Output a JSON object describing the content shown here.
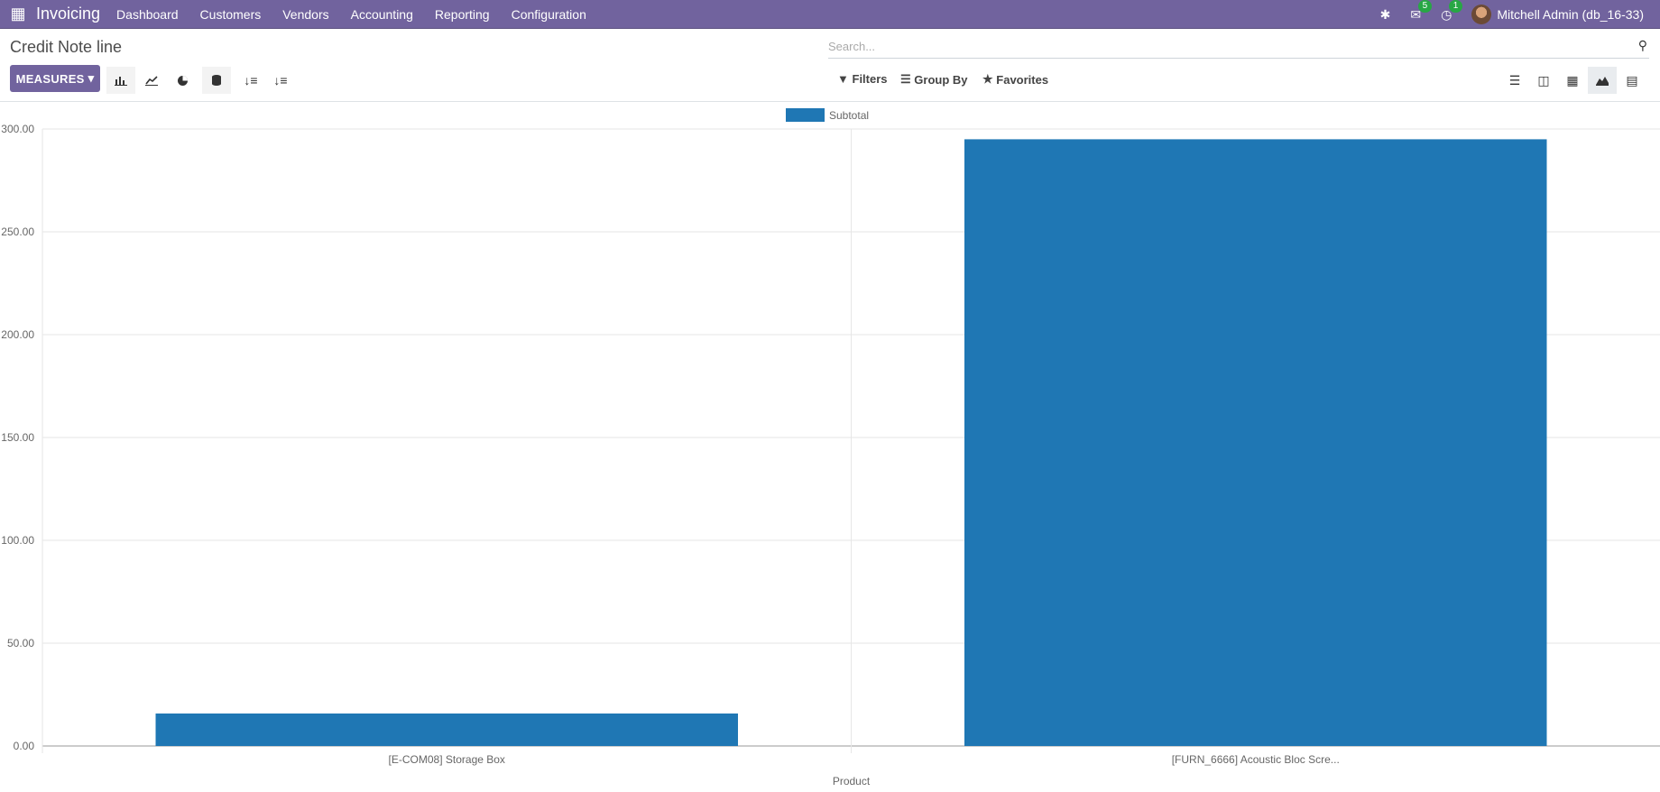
{
  "navbar": {
    "app_name": "Invoicing",
    "menu": [
      "Dashboard",
      "Customers",
      "Vendors",
      "Accounting",
      "Reporting",
      "Configuration"
    ],
    "messages_count": "5",
    "activities_count": "1",
    "user": "Mitchell Admin (db_16-33)"
  },
  "control": {
    "breadcrumb": "Credit Note line",
    "search_placeholder": "Search...",
    "measures_label": "MEASURES",
    "filters_label": "Filters",
    "groupby_label": "Group By",
    "favorites_label": "Favorites"
  },
  "colors": {
    "accent": "#71639e",
    "bar": "#1f77b4"
  },
  "chart_data": {
    "type": "bar",
    "categories": [
      "[E-COM08] Storage Box",
      "[FURN_6666] Acoustic Bloc Scre..."
    ],
    "series": [
      {
        "name": "Subtotal",
        "values": [
          15.8,
          295.0
        ]
      }
    ],
    "xlabel": "Product",
    "ylabel": "",
    "ylim": [
      0,
      300
    ],
    "yticks": [
      "0.00",
      "50.00",
      "100.00",
      "150.00",
      "200.00",
      "250.00",
      "300.00"
    ],
    "legend": "top-center",
    "grid": true
  }
}
